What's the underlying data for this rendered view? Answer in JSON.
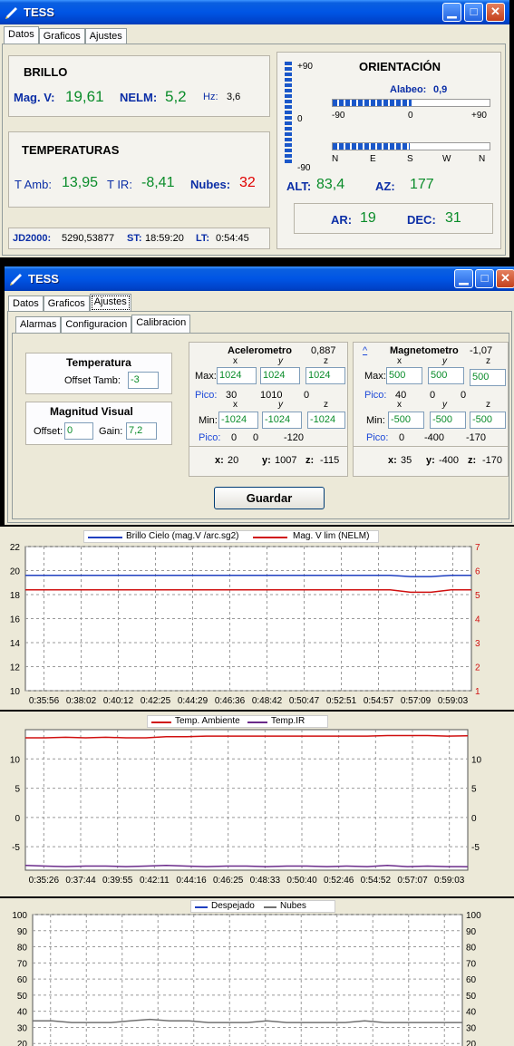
{
  "window1": {
    "title": "TESS",
    "tabs": [
      "Datos",
      "Graficos",
      "Ajustes"
    ],
    "brillo": {
      "title": "BRILLO",
      "mag_label": "Mag. V:",
      "mag_value": "19,61",
      "nelm_label": "NELM:",
      "nelm_value": "5,2",
      "hz_label": "Hz:",
      "hz_value": "3,6"
    },
    "temperaturas": {
      "title": "TEMPERATURAS",
      "tamb_label": "T Amb:",
      "tamb_value": "13,95",
      "tir_label": "T IR:",
      "tir_value": "-8,41",
      "nubes_label": "Nubes:",
      "nubes_value": "32"
    },
    "status": {
      "jd_label": "JD2000:",
      "jd_value": "5290,53877",
      "st_label": "ST:",
      "st_value": "18:59:20",
      "lt_label": "LT:",
      "lt_value": "0:54:45"
    },
    "orientacion": {
      "title": "ORIENTACIÓN",
      "alabeo_label": "Alabeo:",
      "alabeo_value": "0,9",
      "tilt_top": "+90",
      "tilt_mid": "0",
      "tilt_bottom": "-90",
      "roll_scale": [
        "-90",
        "0",
        "+90"
      ],
      "compass": [
        "N",
        "E",
        "S",
        "W",
        "N"
      ],
      "roll_fraction": 0.5,
      "azimuth_fraction": 0.49,
      "tilt_fraction": 0.96,
      "alt_label": "ALT:",
      "alt_value": "83,4",
      "az_label": "AZ:",
      "az_value": "177",
      "ar_label": "AR:",
      "ar_value": "19",
      "dec_label": "DEC:",
      "dec_value": "31"
    }
  },
  "window2": {
    "title": "TESS",
    "tabs": [
      "Datos",
      "Graficos",
      "Ajustes"
    ],
    "subtabs": [
      "Alarmas",
      "Configuracion",
      "Calibracion"
    ],
    "temperatura": {
      "title": "Temperatura",
      "offset_label": "Offset Tamb:",
      "offset_value": "-3"
    },
    "magnitud": {
      "title": "Magnitud Visual",
      "offset_label": "Offset:",
      "offset_value": "0",
      "gain_label": "Gain:",
      "gain_value": "7,2"
    },
    "acc": {
      "title": "Acelerometro",
      "reading": "0,887",
      "axes": [
        "x",
        "y",
        "z"
      ],
      "max_label": "Max:",
      "max": [
        "1024",
        "1024",
        "1024"
      ],
      "pico_label": "Pico:",
      "pico_max": [
        "30",
        "1010",
        "0"
      ],
      "min_label": "Min:",
      "min": [
        "-1024",
        "-1024",
        "-1024"
      ],
      "pico_min": [
        "0",
        "0",
        "-120"
      ],
      "cur": {
        "x_label": "x:",
        "x": "20",
        "y_label": "y:",
        "y": "1007",
        "z_label": "z:",
        "z": "-115"
      }
    },
    "mag": {
      "title": "Magnetometro",
      "reading": "-1,07",
      "caret": "^",
      "axes": [
        "x",
        "y",
        "z"
      ],
      "max_label": "Max:",
      "max": [
        "500",
        "500",
        "500"
      ],
      "pico_label": "Pico:",
      "pico_max": [
        "40",
        "0",
        "0"
      ],
      "min_label": "Min:",
      "min": [
        "-500",
        "-500",
        "-500"
      ],
      "pico_min": [
        "0",
        "-400",
        "-170"
      ],
      "cur": {
        "x_label": "x:",
        "x": "35",
        "y_label": "y:",
        "y": "-400",
        "z_label": "z:",
        "z": "-170"
      }
    },
    "save_label": "Guardar"
  },
  "chart_data": [
    {
      "type": "line",
      "series": [
        {
          "name": "Brillo Cielo (mag.V /arc.sg2)",
          "color": "#1f3fc0",
          "axis": "left",
          "values": [
            19.6,
            19.6,
            19.6,
            19.6,
            19.6,
            19.6,
            19.6,
            19.6,
            19.6,
            19.6,
            19.6,
            19.6,
            19.6,
            19.6,
            19.6,
            19.6,
            19.6,
            19.6,
            19.6,
            19.5,
            19.5,
            19.6,
            19.6
          ]
        },
        {
          "name": "Mag. V lim (NELM)",
          "color": "#d01010",
          "axis": "right",
          "values": [
            5.2,
            5.2,
            5.2,
            5.2,
            5.2,
            5.2,
            5.2,
            5.2,
            5.2,
            5.2,
            5.2,
            5.2,
            5.2,
            5.2,
            5.2,
            5.2,
            5.2,
            5.2,
            5.2,
            5.1,
            5.1,
            5.2,
            5.2
          ]
        }
      ],
      "x_ticks": [
        "0:35:56",
        "0:38:02",
        "0:40:12",
        "0:42:25",
        "0:44:29",
        "0:46:36",
        "0:48:42",
        "0:50:47",
        "0:52:51",
        "0:54:57",
        "0:57:09",
        "0:59:03"
      ],
      "ylim": [
        10,
        22
      ],
      "y_ticks": [
        "10",
        "12",
        "14",
        "16",
        "18",
        "20",
        "22"
      ],
      "y2lim": [
        1,
        7
      ],
      "y2_ticks": [
        "1",
        "2",
        "3",
        "4",
        "5",
        "6",
        "7"
      ],
      "grid": true,
      "legend": "top"
    },
    {
      "type": "line",
      "series": [
        {
          "name": "Temp. Ambiente",
          "color": "#d01010",
          "values": [
            13.6,
            13.6,
            13.7,
            13.6,
            13.7,
            13.6,
            13.6,
            13.8,
            13.8,
            13.9,
            13.9,
            13.9,
            13.9,
            13.9,
            13.9,
            13.9,
            13.9,
            13.9,
            14.0,
            14.0,
            14.0,
            13.9,
            13.95
          ]
        },
        {
          "name": "Temp.IR",
          "color": "#6a2a8a",
          "values": [
            -8.2,
            -8.3,
            -8.4,
            -8.3,
            -8.3,
            -8.4,
            -8.3,
            -8.2,
            -8.3,
            -8.4,
            -8.3,
            -8.3,
            -8.4,
            -8.3,
            -8.3,
            -8.4,
            -8.3,
            -8.4,
            -8.2,
            -8.4,
            -8.3,
            -8.4,
            -8.41
          ]
        }
      ],
      "x_ticks": [
        "0:35:26",
        "0:37:44",
        "0:39:55",
        "0:42:11",
        "0:44:16",
        "0:46:25",
        "0:48:33",
        "0:50:40",
        "0:52:46",
        "0:54:52",
        "0:57:07",
        "0:59:03"
      ],
      "ylim": [
        -9,
        15
      ],
      "y_ticks": [
        "-5",
        "0",
        "5",
        "10"
      ],
      "y2_ticks": [
        "-5",
        "0",
        "5",
        "10"
      ],
      "grid": true,
      "legend": "top"
    },
    {
      "type": "line",
      "series": [
        {
          "name": "Despejado",
          "color": "#1f3fc0",
          "values": []
        },
        {
          "name": "Nubes",
          "color": "#707070",
          "values": [
            34,
            34,
            33,
            33,
            33,
            34,
            35,
            34,
            34,
            33,
            33,
            33,
            34,
            33,
            33,
            33,
            33,
            34,
            33,
            33,
            33,
            33,
            33
          ]
        }
      ],
      "ylim": [
        10,
        100
      ],
      "y_ticks": [
        "20",
        "30",
        "40",
        "50",
        "60",
        "70",
        "80",
        "90",
        "100"
      ],
      "y2_ticks": [
        "20",
        "30",
        "40",
        "50",
        "60",
        "70",
        "80",
        "90",
        "100"
      ],
      "grid": true,
      "legend": "top"
    }
  ]
}
